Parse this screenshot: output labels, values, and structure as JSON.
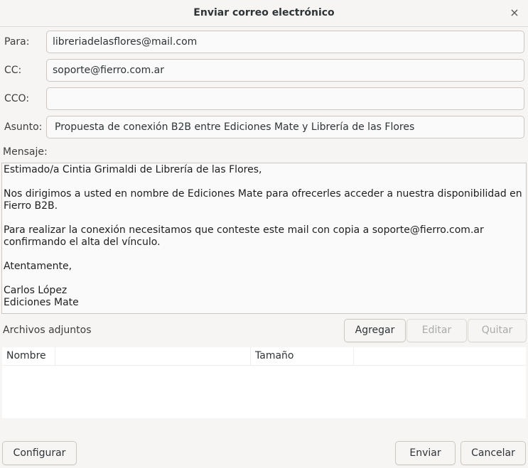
{
  "window": {
    "title": "Enviar correo electrónico",
    "close_glyph": "×"
  },
  "form": {
    "to_label": "Para:",
    "to_value": "libreriadelasflores@mail.com",
    "cc_label": "CC:",
    "cc_value": "soporte@fierro.com.ar",
    "bcc_label": "CCO:",
    "bcc_value": "",
    "subject_label": "Asunto:",
    "subject_value": "Propuesta de conexión B2B entre Ediciones Mate y Librería de las Flores",
    "message_label": "Mensaje:",
    "message_body": "Estimado/a Cintia Grimaldi de Librería de las Flores,\n\nNos dirigimos a usted en nombre de Ediciones Mate para ofrecerles acceder a nuestra disponibilidad en Fierro B2B.\n\nPara realizar la conexión necesitamos que conteste este mail con copia a soporte@fierro.com.ar confirmando el alta del vínculo.\n\nAtentamente,\n\nCarlos López\nEdiciones Mate"
  },
  "attachments": {
    "label": "Archivos adjuntos",
    "add_label": "Agregar",
    "edit_label": "Editar",
    "remove_label": "Quitar",
    "columns": [
      "Nombre",
      "Tamaño"
    ],
    "rows": []
  },
  "footer": {
    "configure_label": "Configurar",
    "send_label": "Enviar",
    "cancel_label": "Cancelar"
  }
}
